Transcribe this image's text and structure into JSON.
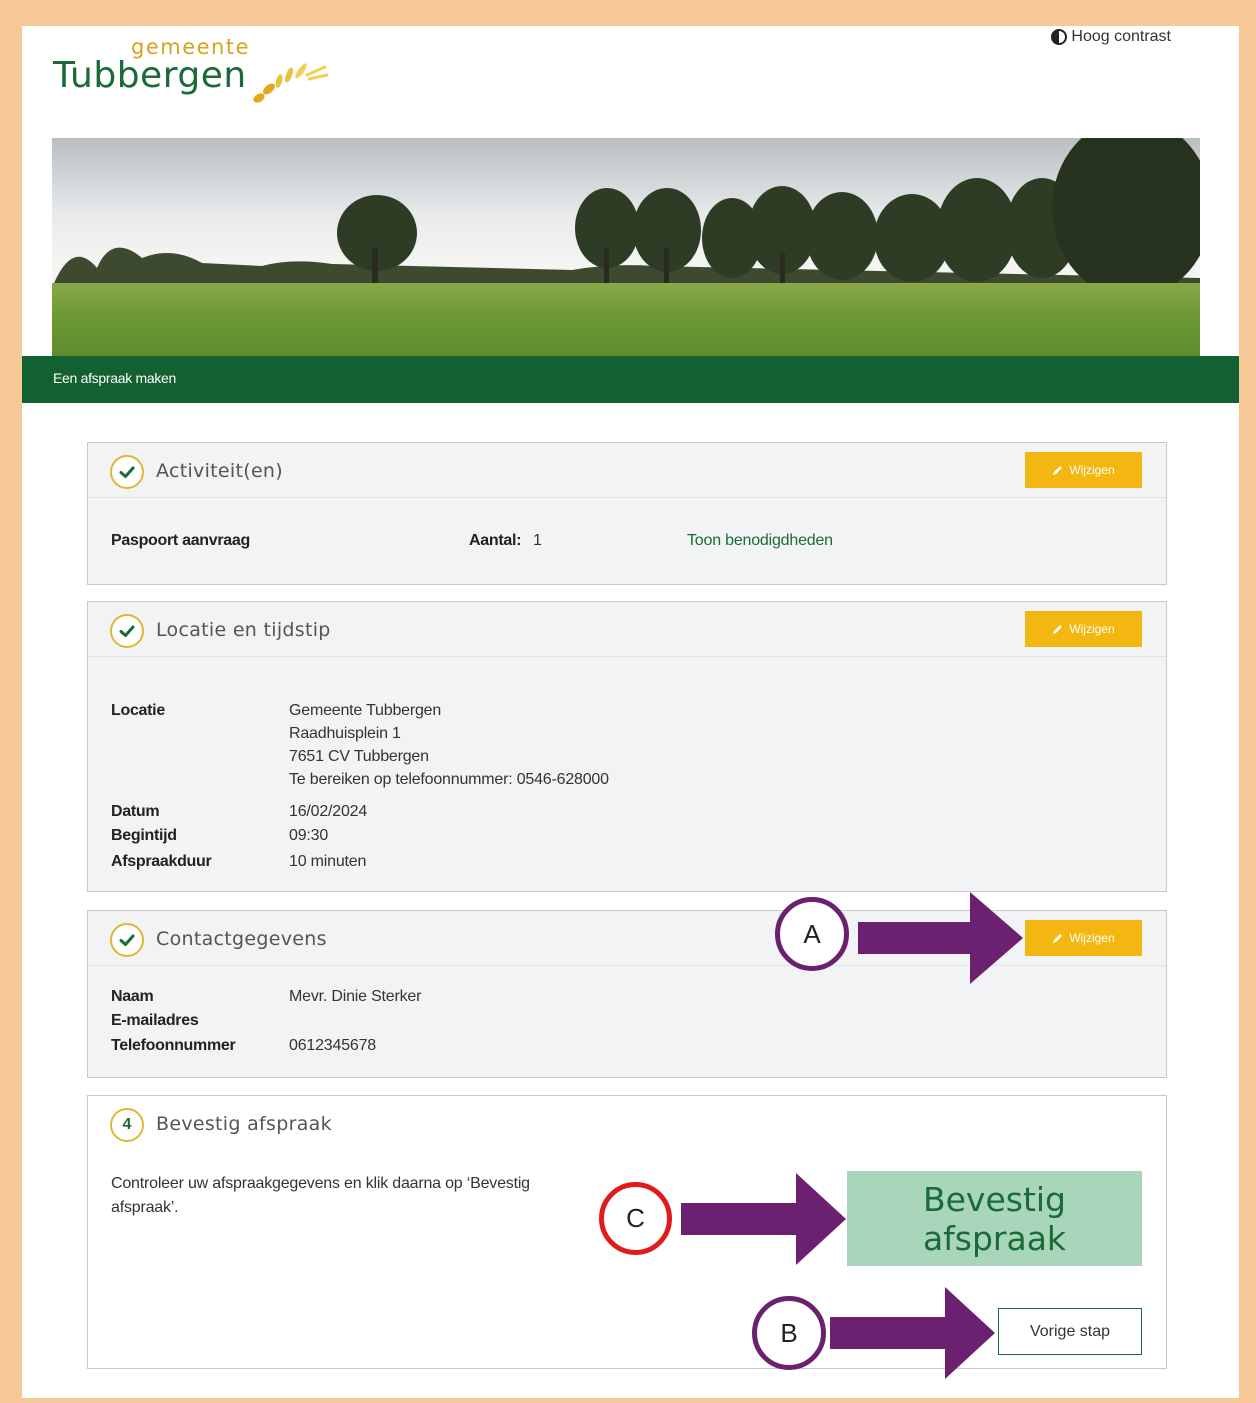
{
  "header": {
    "logo_small": "gemeente",
    "logo_main": "Tubbergen",
    "contrast_label": "Hoog contrast"
  },
  "page_bar": {
    "title": "Een afspraak maken"
  },
  "activities": {
    "title": "Activiteit(en)",
    "edit_label": "Wijzigen",
    "item": "Paspoort aanvraag",
    "count_label": "Aantal:",
    "count": "1",
    "requirements_link": "Toon benodigdheden"
  },
  "location": {
    "title": "Locatie en tijdstip",
    "edit_label": "Wijzigen",
    "location_label": "Locatie",
    "location_lines": [
      "Gemeente Tubbergen",
      "Raadhuisplein 1",
      "7651 CV Tubbergen",
      "Te bereiken op telefoonnummer: 0546-628000"
    ],
    "date_label": "Datum",
    "date": "16/02/2024",
    "start_label": "Begintijd",
    "start": "09:30",
    "duration_label": "Afspraakduur",
    "duration": "10 minuten"
  },
  "contact": {
    "title": "Contactgegevens",
    "edit_label": "Wijzigen",
    "name_label": "Naam",
    "name": "Mevr. Dinie Sterker",
    "email_label": "E-mailadres",
    "email": "",
    "phone_label": "Telefoonnummer",
    "phone": "0612345678"
  },
  "confirm": {
    "step": "4",
    "title": "Bevestig afspraak",
    "instruction": "Controleer uw afspraakgegevens en klik daarna op ‘Bevestig afspraak’.",
    "confirm_label": "Bevestig afspraak",
    "back_label": "Vorige stap"
  },
  "annotations": {
    "a": "A",
    "b": "B",
    "c": "C",
    "arrow_color": "#6b2170",
    "circle_purple": "#6b2170",
    "circle_red": "#e01b1b"
  },
  "colors": {
    "brand_green": "#136030",
    "button_yellow": "#f4b611",
    "confirm_green": "#a9d5ba",
    "frame": "#f5c896"
  }
}
